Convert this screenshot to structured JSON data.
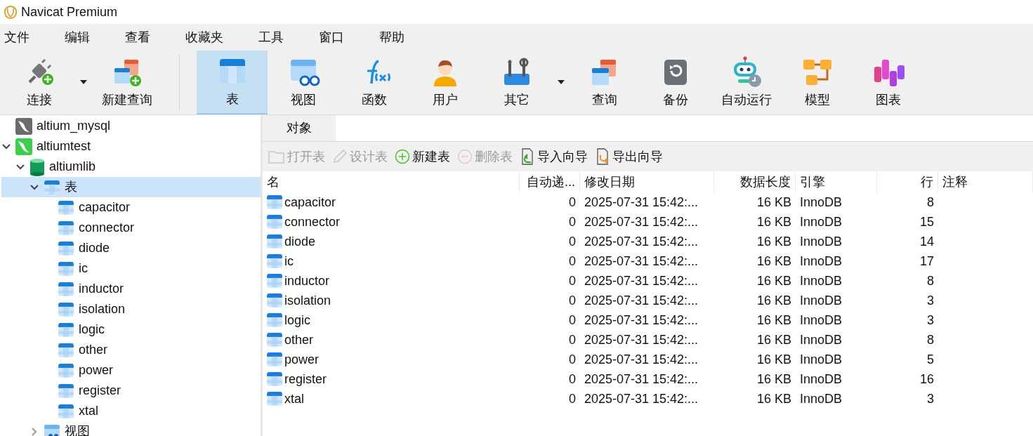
{
  "window": {
    "title": "Navicat Premium"
  },
  "menu": [
    "文件",
    "编辑",
    "查看",
    "收藏夹",
    "工具",
    "窗口",
    "帮助"
  ],
  "toolbar": [
    {
      "label": "连接",
      "kind": "connect",
      "selected": false,
      "has_dropdown": true
    },
    {
      "label": "新建查询",
      "kind": "new-query",
      "selected": false,
      "has_dropdown": false
    },
    {
      "label": "表",
      "kind": "table",
      "selected": true,
      "has_dropdown": false
    },
    {
      "label": "视图",
      "kind": "view",
      "selected": false,
      "has_dropdown": false
    },
    {
      "label": "函数",
      "kind": "function",
      "selected": false,
      "has_dropdown": false
    },
    {
      "label": "用户",
      "kind": "user",
      "selected": false,
      "has_dropdown": false
    },
    {
      "label": "其它",
      "kind": "tools",
      "selected": false,
      "has_dropdown": true
    },
    {
      "label": "查询",
      "kind": "query",
      "selected": false,
      "has_dropdown": false
    },
    {
      "label": "备份",
      "kind": "backup",
      "selected": false,
      "has_dropdown": false
    },
    {
      "label": "自动运行",
      "kind": "robot",
      "selected": false,
      "has_dropdown": false
    },
    {
      "label": "模型",
      "kind": "model",
      "selected": false,
      "has_dropdown": false
    },
    {
      "label": "图表",
      "kind": "chart",
      "selected": false,
      "has_dropdown": false
    }
  ],
  "sidebar": {
    "items": [
      {
        "label": "altium_mysql",
        "kind": "connection-off",
        "selected": false
      },
      {
        "label": "altiumtest",
        "kind": "connection-on",
        "expanded": true,
        "selected": false,
        "children": [
          {
            "label": "altiumlib",
            "kind": "database",
            "expanded": true,
            "selected": false,
            "children": [
              {
                "label": "表",
                "kind": "folder-table",
                "expanded": true,
                "selected": true,
                "children": [
                  {
                    "label": "capacitor",
                    "kind": "table",
                    "selected": false
                  },
                  {
                    "label": "connector",
                    "kind": "table",
                    "selected": false
                  },
                  {
                    "label": "diode",
                    "kind": "table",
                    "selected": false
                  },
                  {
                    "label": "ic",
                    "kind": "table",
                    "selected": false
                  },
                  {
                    "label": "inductor",
                    "kind": "table",
                    "selected": false
                  },
                  {
                    "label": "isolation",
                    "kind": "table",
                    "selected": false
                  },
                  {
                    "label": "logic",
                    "kind": "table",
                    "selected": false
                  },
                  {
                    "label": "other",
                    "kind": "table",
                    "selected": false
                  },
                  {
                    "label": "power",
                    "kind": "table",
                    "selected": false
                  },
                  {
                    "label": "register",
                    "kind": "table",
                    "selected": false
                  },
                  {
                    "label": "xtal",
                    "kind": "table",
                    "selected": false
                  }
                ]
              },
              {
                "label": "视图",
                "kind": "folder-view",
                "expanded": false,
                "selected": false
              }
            ]
          }
        ]
      }
    ]
  },
  "tabs": [
    {
      "label": "对象",
      "selected": true
    }
  ],
  "actions": [
    {
      "label": "打开表",
      "kind": "open",
      "disabled": true
    },
    {
      "label": "设计表",
      "kind": "design",
      "disabled": true
    },
    {
      "label": "新建表",
      "kind": "add",
      "disabled": false
    },
    {
      "label": "删除表",
      "kind": "remove",
      "disabled": true
    },
    {
      "label": "导入向导",
      "kind": "import",
      "disabled": false
    },
    {
      "label": "导出向导",
      "kind": "export",
      "disabled": false
    }
  ],
  "table": {
    "columns": [
      "名",
      "自动递...",
      "修改日期",
      "数据长度",
      "引擎",
      "行",
      "注释"
    ],
    "rows": [
      [
        "capacitor",
        "0",
        "2025-07-31 15:42:...",
        "16 KB",
        "InnoDB",
        "8"
      ],
      [
        "connector",
        "0",
        "2025-07-31 15:42:...",
        "16 KB",
        "InnoDB",
        "15"
      ],
      [
        "diode",
        "0",
        "2025-07-31 15:42:...",
        "16 KB",
        "InnoDB",
        "14"
      ],
      [
        "ic",
        "0",
        "2025-07-31 15:42:...",
        "16 KB",
        "InnoDB",
        "17"
      ],
      [
        "inductor",
        "0",
        "2025-07-31 15:42:...",
        "16 KB",
        "InnoDB",
        "8"
      ],
      [
        "isolation",
        "0",
        "2025-07-31 15:42:...",
        "16 KB",
        "InnoDB",
        "3"
      ],
      [
        "logic",
        "0",
        "2025-07-31 15:42:...",
        "16 KB",
        "InnoDB",
        "3"
      ],
      [
        "other",
        "0",
        "2025-07-31 15:42:...",
        "16 KB",
        "InnoDB",
        "8"
      ],
      [
        "power",
        "0",
        "2025-07-31 15:42:...",
        "16 KB",
        "InnoDB",
        "5"
      ],
      [
        "register",
        "0",
        "2025-07-31 15:42:...",
        "16 KB",
        "InnoDB",
        "16"
      ],
      [
        "xtal",
        "0",
        "2025-07-31 15:42:...",
        "16 KB",
        "InnoDB",
        "3"
      ]
    ]
  }
}
